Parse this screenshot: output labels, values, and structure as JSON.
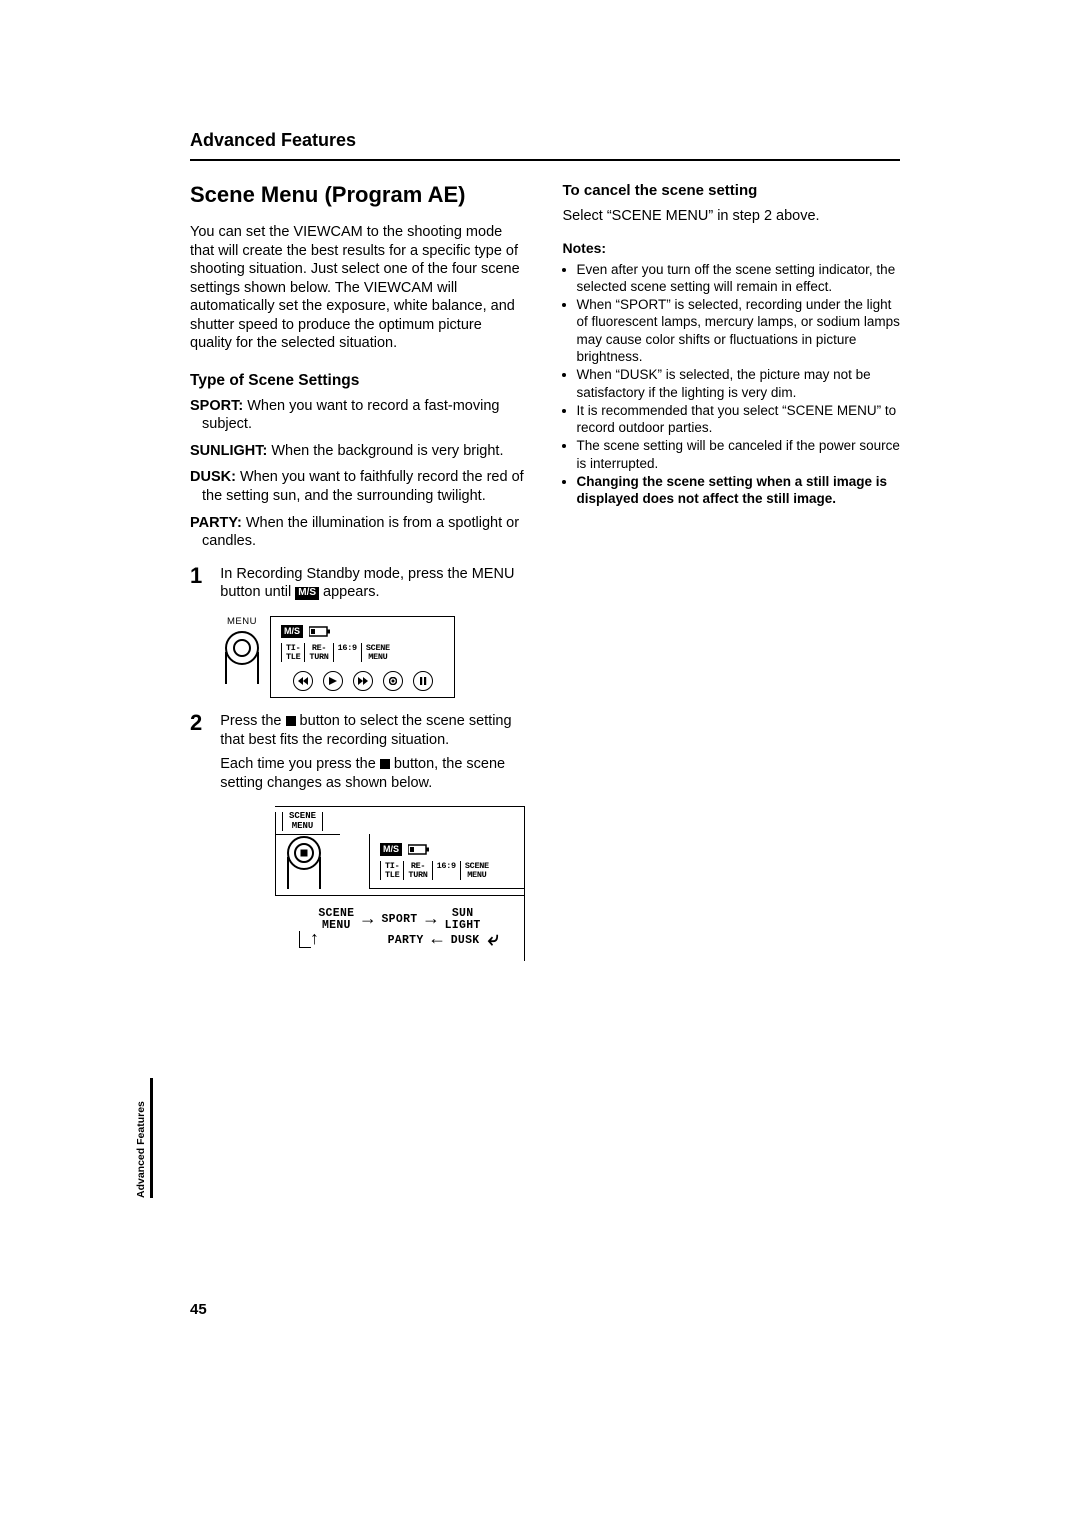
{
  "header": "Advanced Features",
  "title": "Scene Menu (Program AE)",
  "intro": "You can set the VIEWCAM to the shooting mode that will create the best results for a specific type of shooting situation. Just select one of the four scene settings shown below. The VIEWCAM will automatically set the exposure, white balance, and shutter speed to produce the optimum picture quality for the selected situation.",
  "type_heading": "Type of Scene Settings",
  "settings": [
    {
      "name": "SPORT:",
      "desc": " When you want to record a fast-moving subject."
    },
    {
      "name": "SUNLIGHT:",
      "desc": " When the background is very bright."
    },
    {
      "name": "DUSK:",
      "desc": " When you want to faithfully record the red of the setting sun, and the surrounding twilight."
    },
    {
      "name": "PARTY:",
      "desc": " When the illumination is from a spotlight or candles."
    }
  ],
  "step1_num": "1",
  "step1_a": "In Recording Standby mode, press the MENU button until ",
  "step1_glyph": "M/S",
  "step1_b": " appears.",
  "menu_label": "MENU",
  "osd": {
    "ms": "M/S",
    "cells": [
      "TI-\nTLE",
      "RE-\nTURN",
      "16:9",
      "SCENE\nMENU"
    ]
  },
  "step2_num": "2",
  "step2_a": "Press the ",
  "step2_b": " button to select the scene setting that best fits the recording situation.",
  "step2_sub_a": "Each time you press the ",
  "step2_sub_b": " button, the scene setting changes as shown below.",
  "scene_btn": "SCENE\nMENU",
  "cycle": {
    "a": "SCENE\nMENU",
    "b": "SPORT",
    "c": "SUN\nLIGHT",
    "d": "PARTY",
    "e": "DUSK"
  },
  "right": {
    "cancel_h": "To cancel the scene setting",
    "cancel_p": "Select “SCENE MENU” in step 2 above.",
    "notes_h": "Notes:",
    "notes": [
      "Even after you turn off the scene setting indicator, the selected scene setting will remain in effect.",
      "When “SPORT” is selected, recording under the light of fluorescent lamps, mercury lamps, or sodium lamps may cause color shifts or fluctuations in picture brightness.",
      "When “DUSK” is selected, the picture may not be satisfactory if the lighting is very dim.",
      "It is recommended that you select “SCENE MENU” to record outdoor parties.",
      "The scene setting will be canceled if the power source is interrupted."
    ],
    "note_bold": "Changing the scene setting when a still image is displayed does not affect the still image."
  },
  "sidetab": "Advanced Features",
  "pagenum": "45"
}
